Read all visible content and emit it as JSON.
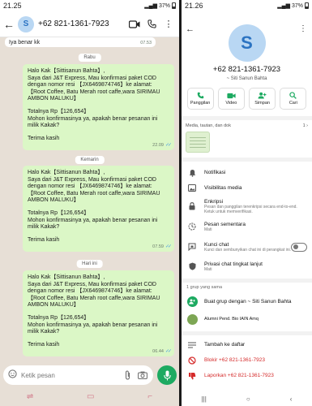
{
  "left": {
    "status": {
      "time": "21.25",
      "battery": "37%"
    },
    "header": {
      "avatar_letter": "S",
      "contact": "+62 821-1361-7923"
    },
    "first_message": {
      "text": "Iya benar kk",
      "time": "07.53"
    },
    "messages": [
      {
        "day": "Rabu",
        "lines": [
          "Halo Kak【Sittisanun Bahta】,",
          "Saya dari J&T Express, Mau konfirmasi paket COD dengan nomor resi 【JX6469874746】ke alamat:",
          "【Root Coffee, Batu Merah  root caffe,wara SIRIMAU AMBON MALUKU】",
          "",
          "Totalnya Rp【126,654】",
          "Mohon konfirmasinya ya, apakah benar pesanan ini milik Kakak?",
          "",
          "Terima kasih"
        ],
        "time": "22.09"
      },
      {
        "day": "Kemarin",
        "lines": [
          "Halo Kak【Sittisanun Bahta】,",
          "Saya dari J&T Express, Mau konfirmasi paket COD dengan nomor resi 【JX6469874746】ke alamat:",
          "【Root Coffee, Batu Merah  root caffe,wara SIRIMAU AMBON MALUKU】",
          "",
          "Totalnya Rp【126,654】",
          "Mohon konfirmasinya ya, apakah benar pesanan ini milik Kakak?",
          "",
          "Terima kasih"
        ],
        "time": "07.59"
      },
      {
        "day": "Hari ini",
        "lines": [
          "Halo Kak【Sittisanun Bahta】,",
          "Saya dari J&T Express, Mau konfirmasi paket COD dengan nomor resi 【JX6469874746】ke alamat:",
          "【Root Coffee, Batu Merah  root caffe,wara SIRIMAU AMBON MALUKU】",
          "",
          "Totalnya Rp【126,654】",
          "Mohon konfirmasinya ya, apakah benar pesanan ini milik Kakak?",
          "",
          "Terima kasih"
        ],
        "time": "06.44"
      }
    ],
    "input_placeholder": "Ketik pesan"
  },
  "right": {
    "status": {
      "time": "21.26",
      "battery": "37%"
    },
    "avatar_letter": "S",
    "phone": "+62 821-1361-7923",
    "alias": "~ Siti Sanun Bahta",
    "actions": [
      "Panggilan",
      "Video",
      "Simpan",
      "Cari"
    ],
    "media_label": "Media, tautan, dan dok",
    "media_count": "1",
    "rows": [
      {
        "title": "Notifikasi",
        "sub": ""
      },
      {
        "title": "Visibilitas media",
        "sub": ""
      },
      {
        "title": "Enkripsi",
        "sub": "Pesan dan panggilan terenkripsi secara end-to-end. Ketuk untuk memverifikasi."
      },
      {
        "title": "Pesan sementara",
        "sub": "Mati"
      },
      {
        "title": "Kunci chat",
        "sub": "Kunci dan sembunyikan chat ini di perangkat ini."
      },
      {
        "title": "Privasi chat tingkat lanjut",
        "sub": "Mati"
      }
    ],
    "groups_label": "1 grup yang sama",
    "group_rows": [
      {
        "title": "Buat grup dengan ~ Siti Sanun Bahta"
      },
      {
        "title": "Alumni Pend. Bio IAIN Amq"
      }
    ],
    "bottom_rows": [
      {
        "title": "Tambah ke daftar",
        "red": false
      },
      {
        "title": "Blokir +62 821-1361-7923",
        "red": true
      },
      {
        "title": "Laporkan +62 821-1361-7923",
        "red": true
      }
    ],
    "colors": {
      "whatsapp_green": "#1daa61",
      "bubble_out": "#dbf7c6",
      "chat_bg": "#e7dfd6",
      "danger": "#d52a2a"
    }
  }
}
